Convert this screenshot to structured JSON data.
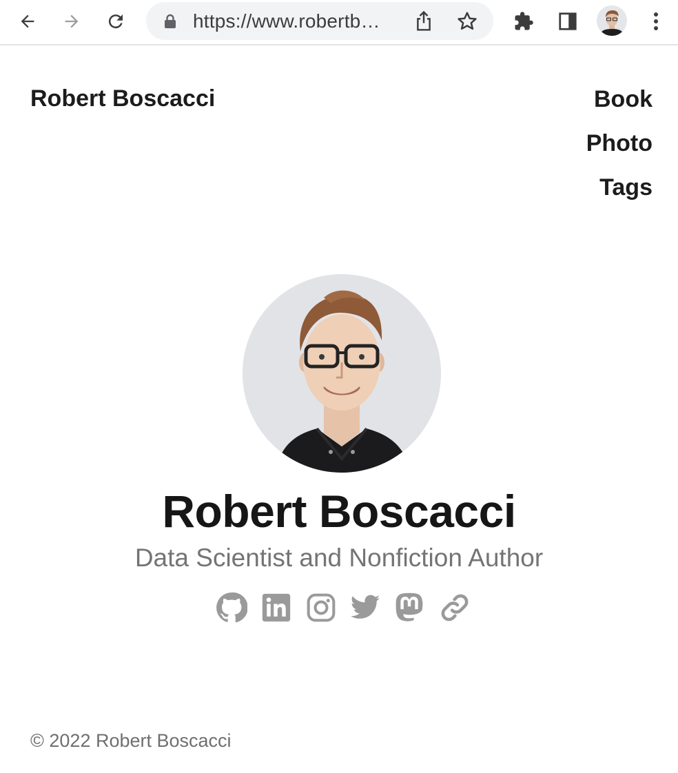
{
  "browser": {
    "url": "https://www.robertb…",
    "icons": [
      "back-icon",
      "forward-icon",
      "reload-icon",
      "lock-icon",
      "share-icon",
      "star-icon",
      "extensions-icon",
      "side-panel-icon",
      "profile-avatar",
      "more-icon"
    ]
  },
  "header": {
    "site_title": "Robert Boscacci",
    "nav": [
      "Book",
      "Photo",
      "Tags"
    ]
  },
  "hero": {
    "name": "Robert Boscacci",
    "subtitle": "Data Scientist and Nonfiction Author",
    "socials": [
      "github-icon",
      "linkedin-icon",
      "instagram-icon",
      "twitter-icon",
      "mastodon-icon",
      "link-icon"
    ]
  },
  "footer": {
    "copyright": "© 2022 Robert Boscacci"
  },
  "colors": {
    "text": "#1c1c1c",
    "muted": "#747474",
    "icon_gray": "#9a9a9a",
    "omnibox": "#f1f3f4"
  }
}
